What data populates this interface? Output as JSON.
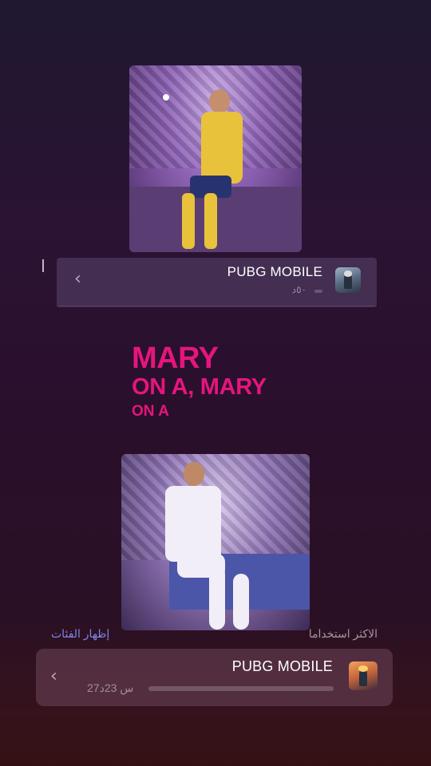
{
  "images": {
    "top_photo": {
      "name": "photo-player-yellow-kit"
    },
    "bottom_photo": {
      "name": "photo-player-white-kit"
    }
  },
  "cards": [
    {
      "title": "PUBG MOBILE",
      "subtitle": "٥٠د",
      "icon": "pubg-app-icon",
      "chevron": "‹"
    },
    {
      "title": "PUBG MOBILE",
      "subtitle": "27س 23د",
      "icon": "pubg-app-icon",
      "chevron": "‹"
    }
  ],
  "lyrics": {
    "line1": "MARY",
    "line2": "ON A, MARY",
    "line3": "ON A"
  },
  "section": {
    "most_used": "الاكثر استخداما",
    "show_categories": "إظهار الفئات"
  },
  "colors": {
    "lyric_accent": "#e6157c",
    "link": "#7d86e6"
  }
}
